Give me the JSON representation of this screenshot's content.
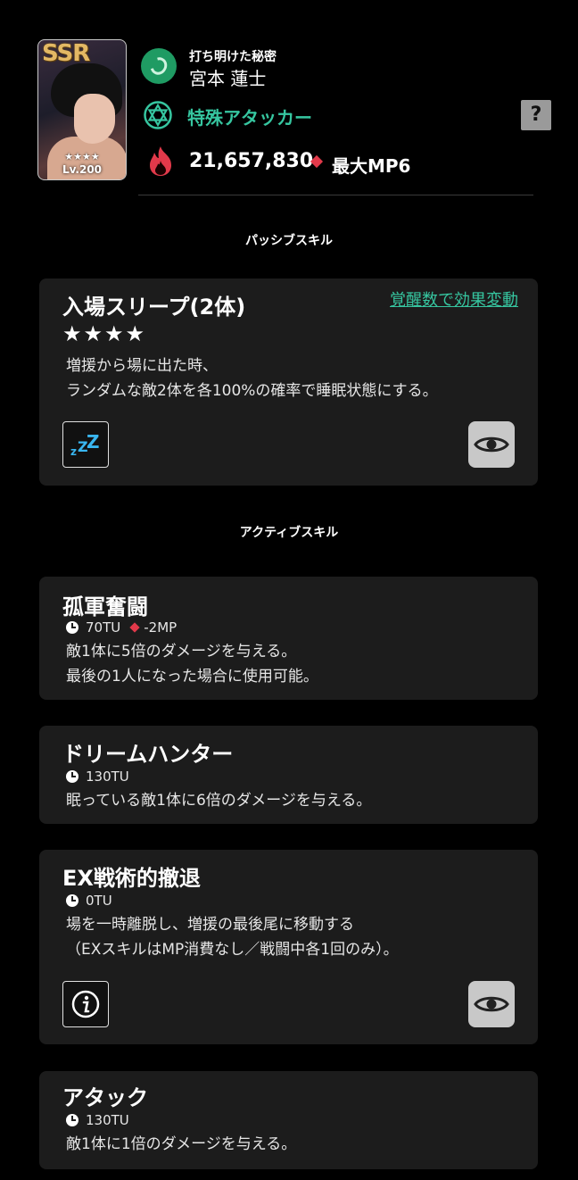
{
  "character": {
    "rarity": "SSR",
    "stars": "★★★★",
    "level": "Lv.200",
    "subtitle": "打ち明けた秘密",
    "name": "宮本 蓮士",
    "role": "特殊アタッカー",
    "power": "21,657,830",
    "max_mp": "最大MP6",
    "help_label": "?"
  },
  "colors": {
    "accent": "#36c6a0",
    "attribute_green": "#1f9b63",
    "mp_red": "#e2394a",
    "card_bg": "#1c1c1c"
  },
  "passive": {
    "section_title": "パッシブスキル",
    "skill": {
      "name": "入場スリープ(2体)",
      "link": "覚醒数で効果変動",
      "stars": "★★★★",
      "description": "増援から場に出た時、\nランダムな敵2体を各100%の確率で睡眠状態にする。",
      "icon": "sleep-icon"
    }
  },
  "active": {
    "section_title": "アクティブスキル",
    "skills": [
      {
        "name": "孤軍奮闘",
        "tu": "70TU",
        "mp": "-2MP",
        "description": "敵1体に5倍のダメージを与える。\n最後の1人になった場合に使用可能。"
      },
      {
        "name": "ドリームハンター",
        "tu": "130TU",
        "description": "眠っている敵1体に6倍のダメージを与える。"
      },
      {
        "name": "EX戦術的撤退",
        "tu": "0TU",
        "description": "場を一時離脱し、増援の最後尾に移動する\n（EXスキルはMP消費なし／戦闘中各1回のみ）。",
        "icon": "info-icon"
      },
      {
        "name": "アタック",
        "tu": "130TU",
        "description": "敵1体に1倍のダメージを与える。"
      }
    ]
  }
}
